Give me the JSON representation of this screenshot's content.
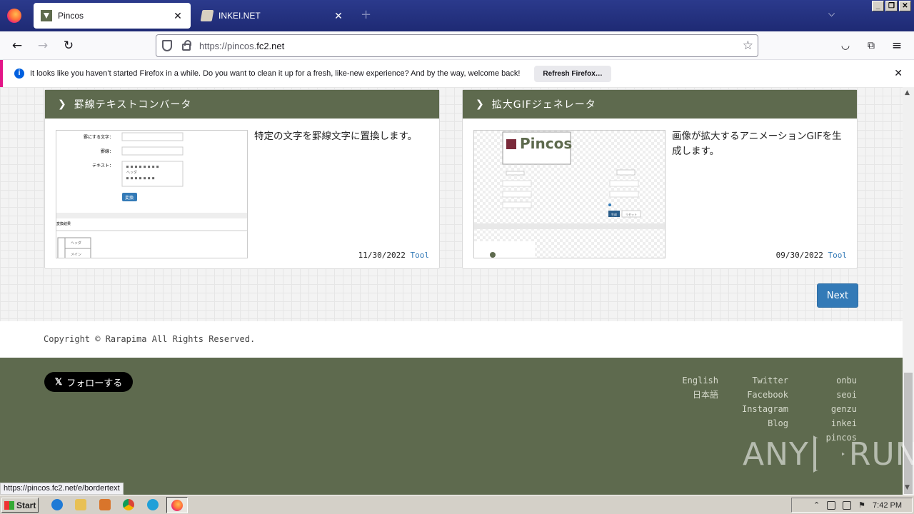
{
  "browser": {
    "tabs": [
      {
        "title": "Pincos",
        "active": true
      },
      {
        "title": "INKEI.NET",
        "active": false
      }
    ],
    "url_prefix": "https://pincos.",
    "url_domain": "fc2.net",
    "notification": {
      "message": "It looks like you haven’t started Firefox in a while. Do you want to clean it up for a fresh, like-new experience? And by the way, welcome back!",
      "button": "Refresh Firefox…"
    },
    "status_url": "https://pincos.fc2.net/e/bordertext"
  },
  "cards": [
    {
      "title": "罫線テキストコンバータ",
      "description": "特定の文字を罫線文字に置換します。",
      "date": "11/30/2022",
      "category": "Tool",
      "preview": {
        "label1": "罫にする文字：",
        "label2": "罫線：",
        "label3": "テキスト：",
        "button": "変換",
        "result": "変換結果",
        "cell1": "ヘッダ",
        "cell2": "メイン"
      }
    },
    {
      "title": "拡大GIFジェネレータ",
      "description": "画像が拡大するアニメーションGIFを生成します。",
      "date": "09/30/2022",
      "category": "Tool",
      "preview": {
        "logo": "Pincos",
        "button1": "生成",
        "button2": "リセット"
      }
    }
  ],
  "pagination": {
    "next": "Next"
  },
  "copyright": "Copyright © Rarapima All Rights Reserved.",
  "footer": {
    "follow_button": "フォローする",
    "languages": [
      "English",
      "日本語"
    ],
    "social": [
      "Twitter",
      "Facebook",
      "Instagram",
      "Blog"
    ],
    "sites": [
      "onbu",
      "seoi",
      "genzu",
      "inkei",
      "pincos"
    ]
  },
  "watermark": {
    "left": "ANY",
    "right": "RUN"
  },
  "taskbar": {
    "start": "Start",
    "clock": "7:42 PM"
  },
  "colors": {
    "header_green": "#5e6a4e",
    "link_blue": "#337ab7",
    "firefox_tabbar": "#1e2a74"
  }
}
